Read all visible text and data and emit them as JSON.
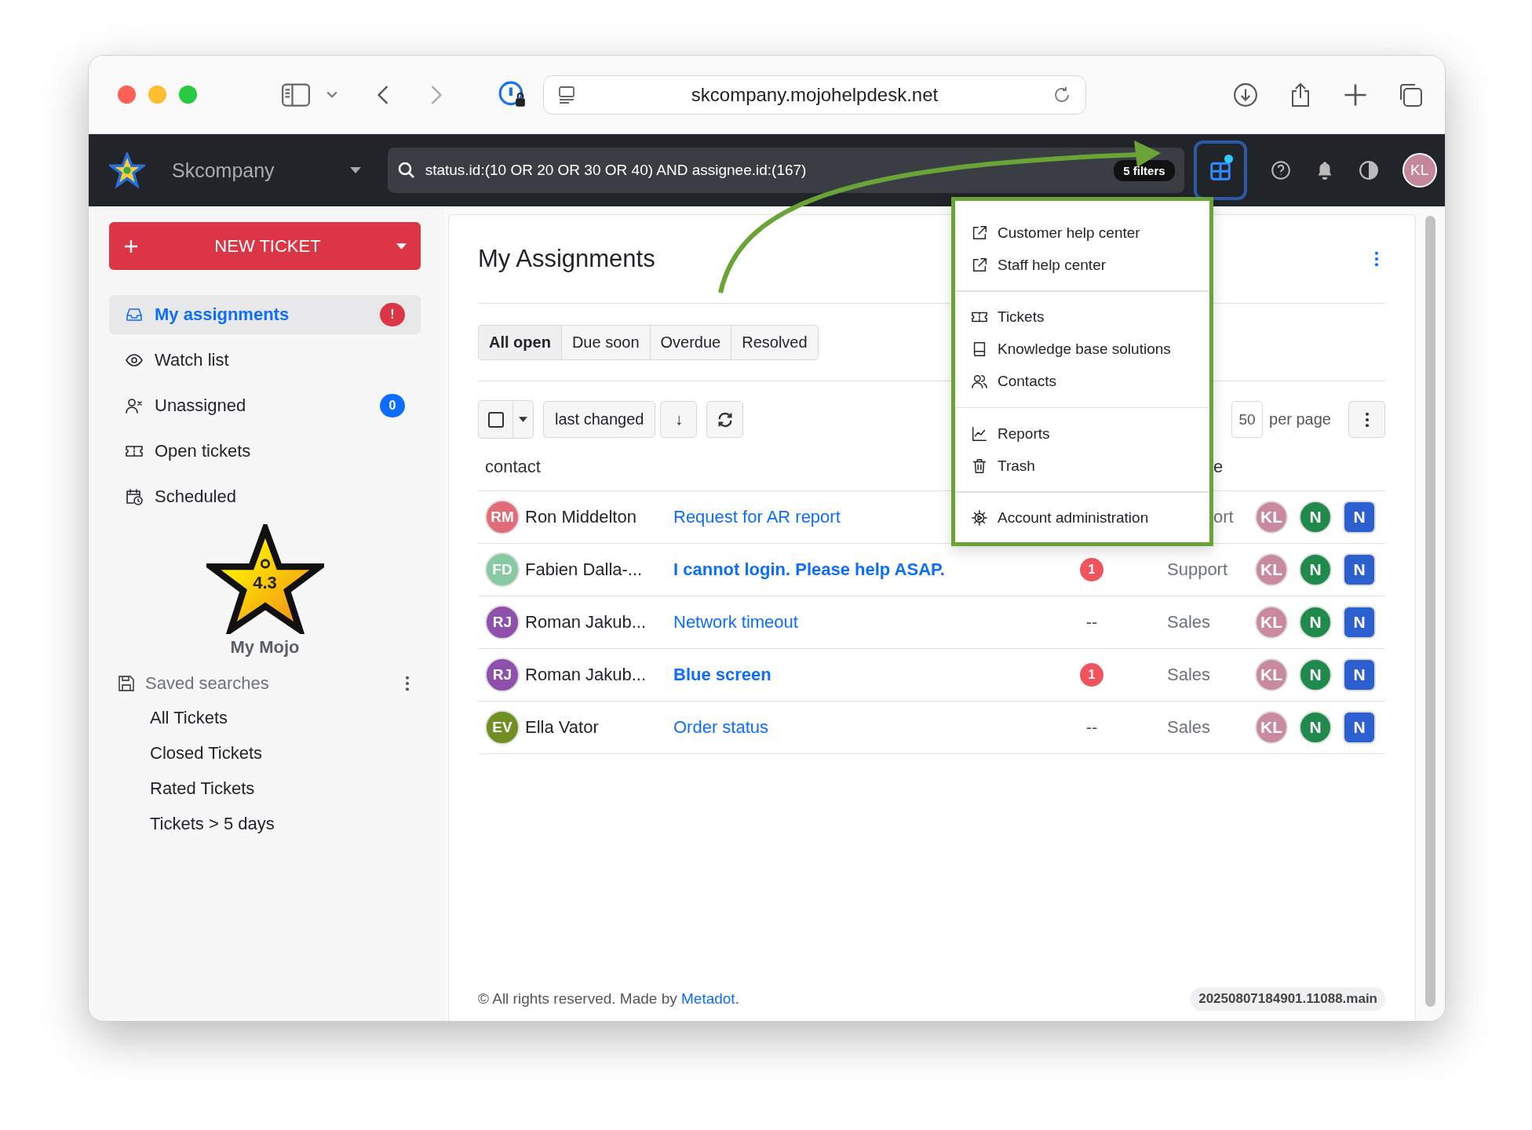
{
  "browser": {
    "url": "skcompany.mojohelpdesk.net"
  },
  "navbar": {
    "company": "Skcompany",
    "search": "status.id:(10 OR 20 OR 30 OR 40) AND assignee.id:(167)",
    "filter_badge": "5 filters",
    "apps_notification": true,
    "avatar": "KL"
  },
  "sidebar": {
    "new_ticket": "NEW TICKET",
    "items": [
      {
        "label": "My assignments",
        "kind": "inbox",
        "selected": true,
        "badge": "!",
        "color": "#dc3545"
      },
      {
        "label": "Watch list",
        "kind": "eye",
        "selected": false
      },
      {
        "label": "Unassigned",
        "kind": "user-x",
        "selected": false,
        "badge": "0",
        "color": "#0d6efd"
      },
      {
        "label": "Open tickets",
        "kind": "ticket",
        "selected": false
      },
      {
        "label": "Scheduled",
        "kind": "calendar",
        "selected": false
      }
    ],
    "mojo": {
      "score": "4.3",
      "label": "My Mojo"
    },
    "saved_searches": {
      "title": "Saved searches",
      "items": [
        "All Tickets",
        "Closed Tickets",
        "Rated Tickets",
        "Tickets > 5 days"
      ]
    }
  },
  "main": {
    "title": "My Assignments",
    "tabs": [
      {
        "label": "All open",
        "selected": true
      },
      {
        "label": "Due soon",
        "selected": false
      },
      {
        "label": "Overdue",
        "selected": false
      },
      {
        "label": "Resolved",
        "selected": false
      }
    ],
    "select_all_checked": false,
    "sort": "last changed",
    "sort_direction": "↓",
    "per_page": "50",
    "per_page_label": "per page",
    "columns": [
      "contact",
      "e"
    ],
    "rows": [
      {
        "initials": "RM",
        "color": "#e06c7a",
        "contact": "Ron Middelton",
        "subject": "Request for AR report",
        "unread": false,
        "group": "ort",
        "group_covered": true,
        "assignees": [
          {
            "initials": "KL",
            "kind": "user",
            "color": "#c98a9f"
          },
          {
            "initials": "N",
            "kind": "user",
            "color": "#1f8a4c"
          },
          {
            "initials": "N",
            "kind": "team",
            "color": "#2c5fd0"
          }
        ]
      },
      {
        "initials": "FD",
        "color": "#86c9a2",
        "contact": "Fabien Dalla-...",
        "subject": "I cannot login. Please help ASAP.",
        "unread": true,
        "flag": {
          "kind": "badge",
          "text": "1"
        },
        "group": "Support",
        "group_covered": false,
        "assignees": [
          {
            "initials": "KL",
            "kind": "user",
            "color": "#c98a9f"
          },
          {
            "initials": "N",
            "kind": "user",
            "color": "#1f8a4c"
          },
          {
            "initials": "N",
            "kind": "team",
            "color": "#2c5fd0"
          }
        ]
      },
      {
        "initials": "RJ",
        "color": "#8e4fad",
        "contact": "Roman Jakub...",
        "subject": "Network timeout",
        "unread": false,
        "flag": {
          "kind": "dash",
          "text": "--"
        },
        "group": "Sales",
        "group_covered": false,
        "assignees": [
          {
            "initials": "KL",
            "kind": "user",
            "color": "#c98a9f"
          },
          {
            "initials": "N",
            "kind": "user",
            "color": "#1f8a4c"
          },
          {
            "initials": "N",
            "kind": "team",
            "color": "#2c5fd0"
          }
        ]
      },
      {
        "initials": "RJ",
        "color": "#8e4fad",
        "contact": "Roman Jakub...",
        "subject": "Blue screen",
        "unread": true,
        "flag": {
          "kind": "badge",
          "text": "1"
        },
        "group": "Sales",
        "group_covered": false,
        "assignees": [
          {
            "initials": "KL",
            "kind": "user",
            "color": "#c98a9f"
          },
          {
            "initials": "N",
            "kind": "user",
            "color": "#1f8a4c"
          },
          {
            "initials": "N",
            "kind": "team",
            "color": "#2c5fd0"
          }
        ]
      },
      {
        "initials": "EV",
        "color": "#6f8f22",
        "contact": "Ella Vator",
        "subject": "Order status",
        "unread": false,
        "flag": {
          "kind": "dash",
          "text": "--"
        },
        "group": "Sales",
        "group_covered": false,
        "assignees": [
          {
            "initials": "KL",
            "kind": "user",
            "color": "#c98a9f"
          },
          {
            "initials": "N",
            "kind": "user",
            "color": "#1f8a4c"
          },
          {
            "initials": "N",
            "kind": "team",
            "color": "#2c5fd0"
          }
        ]
      }
    ],
    "footer": {
      "text": "© All rights reserved. Made by ",
      "link": "Metadot",
      "after": ".",
      "version": "20250807184901.11088.main"
    }
  },
  "apps_menu": {
    "open": true,
    "groups": [
      [
        {
          "label": "Customer help center",
          "kind": "external"
        },
        {
          "label": "Staff help center",
          "kind": "external"
        }
      ],
      [
        {
          "label": "Tickets",
          "kind": "ticket"
        },
        {
          "label": "Knowledge base solutions",
          "kind": "book"
        },
        {
          "label": "Contacts",
          "kind": "people"
        }
      ],
      [
        {
          "label": "Reports",
          "kind": "chart"
        },
        {
          "label": "Trash",
          "kind": "trash"
        }
      ],
      [
        {
          "label": "Account administration",
          "kind": "gear"
        }
      ]
    ]
  }
}
